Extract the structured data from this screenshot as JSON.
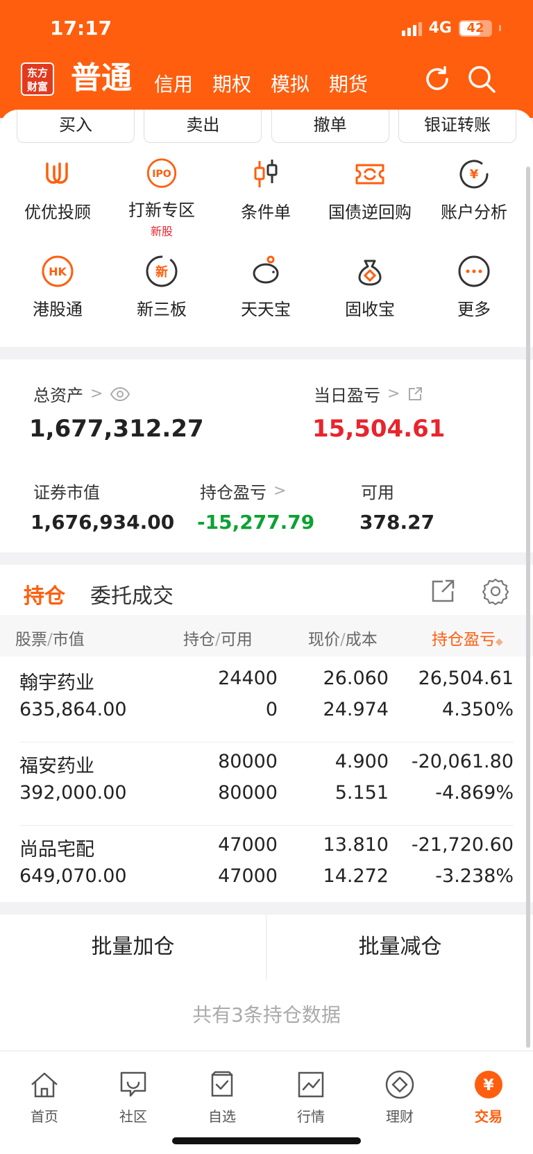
{
  "status": {
    "time": "17:17",
    "network": "4G",
    "battery": "42"
  },
  "logo": {
    "line1": "东方",
    "line2": "财富"
  },
  "nav": {
    "tabs": [
      "普通",
      "信用",
      "期权",
      "模拟",
      "期货"
    ]
  },
  "quick_actions": [
    "买入",
    "卖出",
    "撤单",
    "银证转账"
  ],
  "functions": [
    {
      "label": "优优投顾",
      "icon": "uu-advisor-icon",
      "badge": ""
    },
    {
      "label": "打新专区",
      "icon": "ipo-icon",
      "badge": "新股"
    },
    {
      "label": "条件单",
      "icon": "candlestick-icon",
      "badge": ""
    },
    {
      "label": "国债逆回购",
      "icon": "repo-icon",
      "badge": ""
    },
    {
      "label": "账户分析",
      "icon": "account-analysis-icon",
      "badge": ""
    },
    {
      "label": "港股通",
      "icon": "hk-icon",
      "badge": ""
    },
    {
      "label": "新三板",
      "icon": "new-board-icon",
      "badge": ""
    },
    {
      "label": "天天宝",
      "icon": "piggy-bank-icon",
      "badge": ""
    },
    {
      "label": "固收宝",
      "icon": "money-bag-icon",
      "badge": ""
    },
    {
      "label": "更多",
      "icon": "more-icon",
      "badge": ""
    }
  ],
  "assets": {
    "total_label": "总资产",
    "total_value": "1,677,312.27",
    "daily_label": "当日盈亏",
    "daily_value": "15,504.61",
    "market_label": "证券市值",
    "market_value": "1,676,934.00",
    "position_pl_label": "持仓盈亏",
    "position_pl_value": "-15,277.79",
    "available_label": "可用",
    "available_value": "378.27"
  },
  "holdings": {
    "tabs": [
      "持仓",
      "委托成交"
    ],
    "headers": {
      "stock": "股票",
      "market_value": "市值",
      "position": "持仓",
      "available": "可用",
      "price": "现价",
      "cost": "成本",
      "pl": "持仓盈亏"
    },
    "rows": [
      {
        "name": "翰宇药业",
        "market_value": "635,864.00",
        "position": "24400",
        "available": "0",
        "price": "26.060",
        "cost": "24.974",
        "pl": "26,504.61",
        "pl_pct": "4.350%",
        "dir": "up"
      },
      {
        "name": "福安药业",
        "market_value": "392,000.00",
        "position": "80000",
        "available": "80000",
        "price": "4.900",
        "cost": "5.151",
        "pl": "-20,061.80",
        "pl_pct": "-4.869%",
        "dir": "down"
      },
      {
        "name": "尚品宅配",
        "market_value": "649,070.00",
        "position": "47000",
        "available": "47000",
        "price": "13.810",
        "cost": "14.272",
        "pl": "-21,720.60",
        "pl_pct": "-3.238%",
        "dir": "down"
      }
    ]
  },
  "bulk": {
    "add": "批量加仓",
    "reduce": "批量减仓"
  },
  "footer_note": "共有3条持仓数据",
  "tabbar": [
    "首页",
    "社区",
    "自选",
    "行情",
    "理财",
    "交易"
  ],
  "colors": {
    "brand": "#ff5e0e",
    "up": "#e8242c",
    "down": "#0ca233"
  }
}
